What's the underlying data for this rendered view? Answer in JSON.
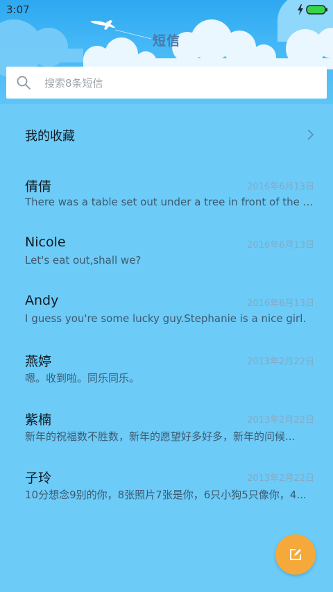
{
  "status_bar": {
    "time": "3:07",
    "bolt_icon": "charging-bolt-icon",
    "battery_icon": "battery-icon",
    "battery_color": "#37d34a"
  },
  "header": {
    "title": "短信",
    "title_color": "#4a78a8",
    "plane_icon": "airplane-icon"
  },
  "search": {
    "placeholder": "搜索8条短信",
    "icon": "search-icon"
  },
  "favorites": {
    "label": "我的收藏",
    "icon": "chevron-right-icon"
  },
  "conversations": [
    {
      "name": "倩倩",
      "date": "2016年6月13日",
      "preview": "There was a table set out under a tree in front of the ho..."
    },
    {
      "name": "Nicole",
      "date": "2016年6月13日",
      "preview": "Let's eat out,shall we?"
    },
    {
      "name": "Andy",
      "date": "2016年6月13日",
      "preview": "I guess you're some lucky guy.Stephanie is a nice girl."
    },
    {
      "name": "燕婷",
      "date": "2013年2月22日",
      "preview": "嗯。收到啦。同乐同乐。"
    },
    {
      "name": "紫楠",
      "date": "2013年2月22日",
      "preview": "新年的祝福数不胜数，新年的愿望好多好多，新年的问候..."
    },
    {
      "name": "子玲",
      "date": "2013年2月22日",
      "preview": "10分想念9别的你，8张照片7张是你，6只小狗5只像你，4..."
    }
  ],
  "fab": {
    "icon": "compose-icon",
    "color": "#f6a93b"
  },
  "colors": {
    "background": "#6ccbf7",
    "header_sky": "#2da8f0"
  }
}
